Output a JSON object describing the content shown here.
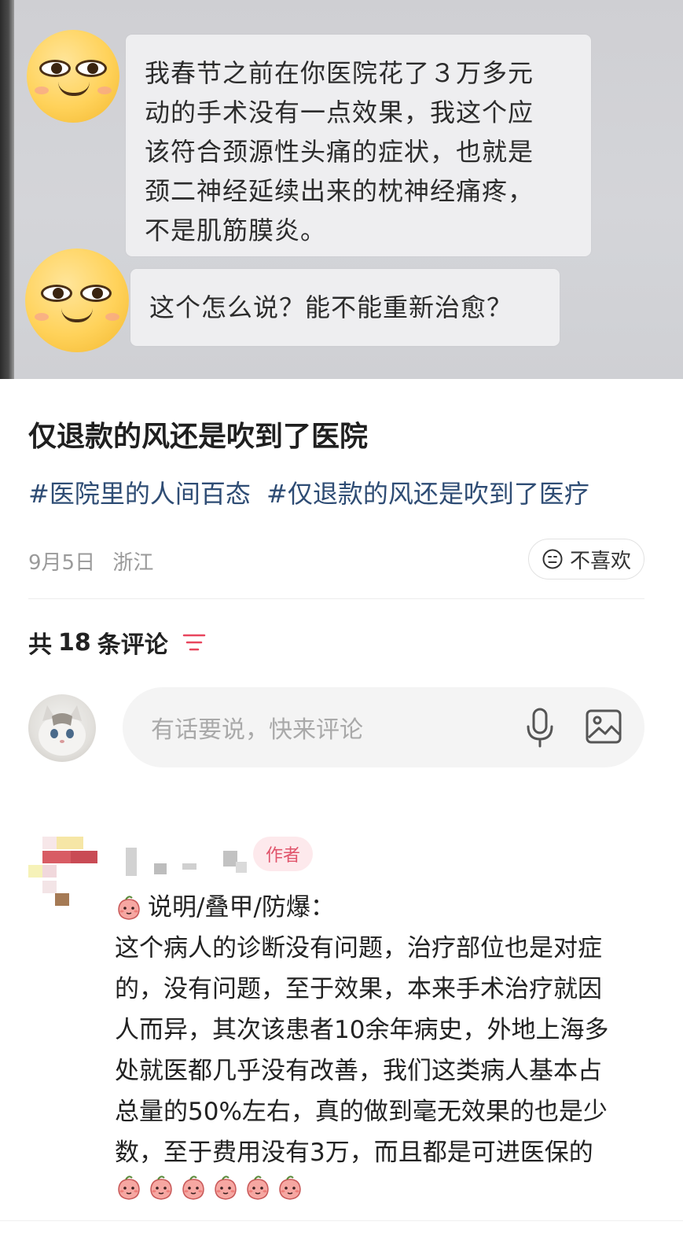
{
  "photo": {
    "messages": [
      {
        "lines": [
          "我春节之前在你医院花了３万多元",
          "动的手术没有一点效果，我这个应",
          "该符合颈源性头痛的症状，也就是",
          "颈二神经延续出来的枕神经痛疼，",
          "不是肌筋膜炎。"
        ]
      },
      {
        "lines": [
          "这个怎么说？能不能重新治愈？"
        ]
      }
    ]
  },
  "post": {
    "title": "仅退款的风还是吹到了医院",
    "tags": [
      "#医院里的人间百态",
      "#仅退款的风还是吹到了医疗"
    ],
    "date": "9月5日",
    "location": "浙江",
    "dislike_label": "不喜欢"
  },
  "comments_header": {
    "prefix": "共",
    "count": "18",
    "suffix": "条评论"
  },
  "comment_input": {
    "placeholder": "有话要说，快来评论"
  },
  "comments": [
    {
      "badge": "作者",
      "lead": "说明/叠甲/防爆：",
      "lines": [
        "这个病人的诊断没有问题，治疗部位也是对症",
        "的，没有问题，至于效果，本来手术治疗就因",
        "人而异，其次该患者10余年病史，外地上海多",
        "处就医都几乎没有改善，我们这类病人基本占",
        "总量的50%左右，真的做到毫无效果的也是少",
        "数，至于费用没有3万，而且都是可进医保的"
      ],
      "trailing_emoji_count": 6
    }
  ],
  "colors": {
    "tag": "#2e4c74",
    "badge_bg": "#fde9ec",
    "badge_text": "#e0546b",
    "sort_icon": "#e8465e"
  },
  "icons": [
    "smiley-face-emoji",
    "neutral-face-icon",
    "sort-filter-icon",
    "microphone-icon",
    "image-icon",
    "peach-emoji"
  ]
}
